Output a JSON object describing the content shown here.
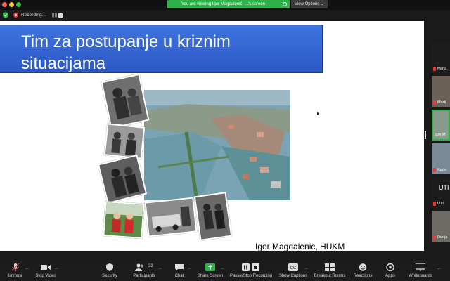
{
  "recording": {
    "label": "Recording..."
  },
  "share_banner": {
    "text": "You are viewing Igor Magdalenić ·...'s screen"
  },
  "view_options": {
    "label": "View Options ⌄"
  },
  "slide": {
    "title_line1": "Tim za postupanje u kriznim",
    "title_line2": "situacijama",
    "author": "Igor Magdalenić, HUKM"
  },
  "gallery": [
    {
      "name": "ivana"
    },
    {
      "name": "Marti"
    },
    {
      "name": "Igor M"
    },
    {
      "name": "Karlo"
    },
    {
      "name": "UTI",
      "big": "UTI"
    },
    {
      "name": "Darija"
    }
  ],
  "toolbar": {
    "unmute": "Unmute",
    "stop_video": "Stop Video",
    "security": "Security",
    "participants": "Participants",
    "participants_count": "33",
    "chat": "Chat",
    "share_screen": "Share Screen",
    "pause_stop_recording": "Pause/Stop Recording",
    "show_captions": "Show Captions",
    "breakout_rooms": "Breakout Rooms",
    "reactions": "Reactions",
    "apps": "Apps",
    "whiteboards": "Whiteboards"
  },
  "colors": {
    "title_blue": "#3f74de",
    "share_green": "#2db34a",
    "recording_red": "#ee3333"
  }
}
